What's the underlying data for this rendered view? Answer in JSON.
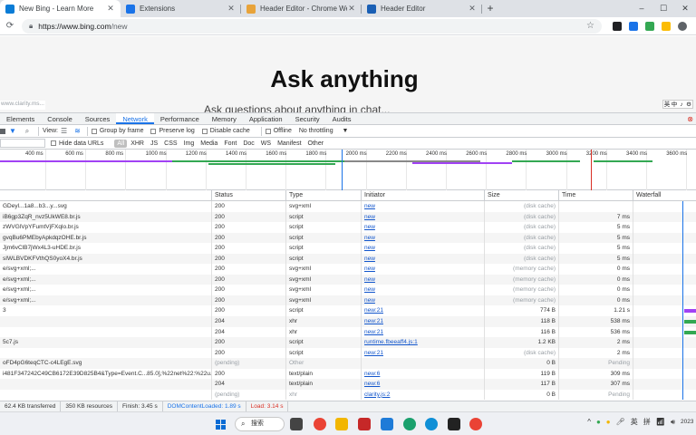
{
  "browser": {
    "tabs": [
      {
        "title": "New Bing - Learn More",
        "active": true,
        "favicon_color": "#0a7cd6"
      },
      {
        "title": "Extensions",
        "active": false,
        "favicon_color": "#1a73e8"
      },
      {
        "title": "Header Editor - Chrome Web",
        "active": false,
        "favicon_color": "#e8a33a"
      },
      {
        "title": "Header Editor",
        "active": false,
        "favicon_color": "#1a5fb4"
      }
    ],
    "new_tab": "+",
    "address": {
      "host": "https://www.bing.com",
      "path": "/new"
    }
  },
  "page": {
    "headline": "Ask anything",
    "subline": "Ask questions about anything in chat...",
    "tooltip": "www.clarity.ms...",
    "ime": [
      "英",
      "中",
      "♪",
      "⚙"
    ]
  },
  "devtools": {
    "tabs": [
      "Elements",
      "Console",
      "Sources",
      "Network",
      "Performance",
      "Memory",
      "Application",
      "Security",
      "Audits"
    ],
    "active_tab": "Network",
    "toolbar": {
      "view_label": "View:",
      "group_by_frame": "Group by frame",
      "preserve_log": "Preserve log",
      "disable_cache": "Disable cache",
      "offline": "Offline",
      "throttling": "No throttling"
    },
    "filter": {
      "hide_data_urls": "Hide data URLs",
      "types": [
        "All",
        "XHR",
        "JS",
        "CSS",
        "Img",
        "Media",
        "Font",
        "Doc",
        "WS",
        "Manifest",
        "Other"
      ]
    },
    "overview_ticks": [
      "400 ms",
      "600 ms",
      "800 ms",
      "1000 ms",
      "1200 ms",
      "1400 ms",
      "1600 ms",
      "1800 ms",
      "2000 ms",
      "2200 ms",
      "2400 ms",
      "2600 ms",
      "2800 ms",
      "3000 ms",
      "3200 ms",
      "3400 ms",
      "3600 ms"
    ],
    "columns": [
      "",
      "Status",
      "Type",
      "Initiator",
      "Size",
      "Time",
      "Waterfall"
    ],
    "rows": [
      {
        "name": "GDeyl...1a8...b3...y...svg",
        "status": "200",
        "type": "svg+xml",
        "initiator": "new",
        "size": "(disk cache)",
        "time": "",
        "pending": false
      },
      {
        "name": "iB6gp3ZqR_nvz5UkWE8.br.js",
        "status": "200",
        "type": "script",
        "initiator": "new",
        "size": "(disk cache)",
        "time": "7 ms",
        "pending": false
      },
      {
        "name": "zWVGlVpYFumtVjFXqlo.br.js",
        "status": "200",
        "type": "script",
        "initiator": "new",
        "size": "(disk cache)",
        "time": "5 ms",
        "pending": false
      },
      {
        "name": "gvqBu6PMEbyApkdqzOHE.br.js",
        "status": "200",
        "type": "script",
        "initiator": "new",
        "size": "(disk cache)",
        "time": "5 ms",
        "pending": false
      },
      {
        "name": "Jjm6vClB7jWx4L3-uHDE.br.js",
        "status": "200",
        "type": "script",
        "initiator": "new",
        "size": "(disk cache)",
        "time": "5 ms",
        "pending": false
      },
      {
        "name": "sIWLBVDKFVthQS0yoX4.br.js",
        "status": "200",
        "type": "script",
        "initiator": "new",
        "size": "(disk cache)",
        "time": "5 ms",
        "pending": false
      },
      {
        "name": "e/svg+xml;...",
        "status": "200",
        "type": "svg+xml",
        "initiator": "new",
        "size": "(memory cache)",
        "time": "0 ms",
        "pending": false
      },
      {
        "name": "e/svg+xml;...",
        "status": "200",
        "type": "svg+xml",
        "initiator": "new",
        "size": "(memory cache)",
        "time": "0 ms",
        "pending": false
      },
      {
        "name": "e/svg+xml;...",
        "status": "200",
        "type": "svg+xml",
        "initiator": "new",
        "size": "(memory cache)",
        "time": "0 ms",
        "pending": false
      },
      {
        "name": "e/svg+xml;...",
        "status": "200",
        "type": "svg+xml",
        "initiator": "new",
        "size": "(memory cache)",
        "time": "0 ms",
        "pending": false
      },
      {
        "name": "3",
        "status": "200",
        "type": "script",
        "initiator": "new:21",
        "size": "774 B",
        "time": "1.21 s",
        "pending": false
      },
      {
        "name": "",
        "status": "204",
        "type": "xhr",
        "initiator": "new:21",
        "size": "118 B",
        "time": "538 ms",
        "pending": false
      },
      {
        "name": "",
        "status": "204",
        "type": "xhr",
        "initiator": "new:21",
        "size": "116 B",
        "time": "536 ms",
        "pending": false
      },
      {
        "name": "5c7.js",
        "status": "200",
        "type": "script",
        "initiator": "runtime.fbeeaff4.js:1",
        "size": "1.2 KB",
        "time": "2 ms",
        "pending": false
      },
      {
        "name": "",
        "status": "200",
        "type": "script",
        "initiator": "new:21",
        "size": "(disk cache)",
        "time": "2 ms",
        "pending": false
      },
      {
        "name": "oFD4pG6teqCTC-c4LEgE.svg",
        "status": "(pending)",
        "type": "Other",
        "initiator": "",
        "size": "0 B",
        "time": "Pending",
        "pending": true
      },
      {
        "name": "i481F347242C49CB6172E39D825B4&Type=Event.C...85.0],%22net%22:%22u...",
        "status": "200",
        "type": "text/plain",
        "initiator": "new:6",
        "size": "119 B",
        "time": "309 ms",
        "pending": false
      },
      {
        "name": "",
        "status": "204",
        "type": "text/plain",
        "initiator": "new:6",
        "size": "117 B",
        "time": "307 ms",
        "pending": false
      },
      {
        "name": "",
        "status": "(pending)",
        "type": "xhr",
        "initiator": "clarity.js:2",
        "size": "0 B",
        "time": "Pending",
        "pending": true
      }
    ],
    "status_bar": {
      "transferred": "62.4 KB transferred",
      "resources": "350 KB resources",
      "finish": "Finish: 3.45 s",
      "dom_loaded": "DOMContentLoaded: 1.89 s",
      "load": "Load: 3.14 s"
    }
  },
  "taskbar": {
    "search_label": "搜索",
    "tray_lang": "英",
    "tray_ime": "拼",
    "clock_year": "2023"
  }
}
